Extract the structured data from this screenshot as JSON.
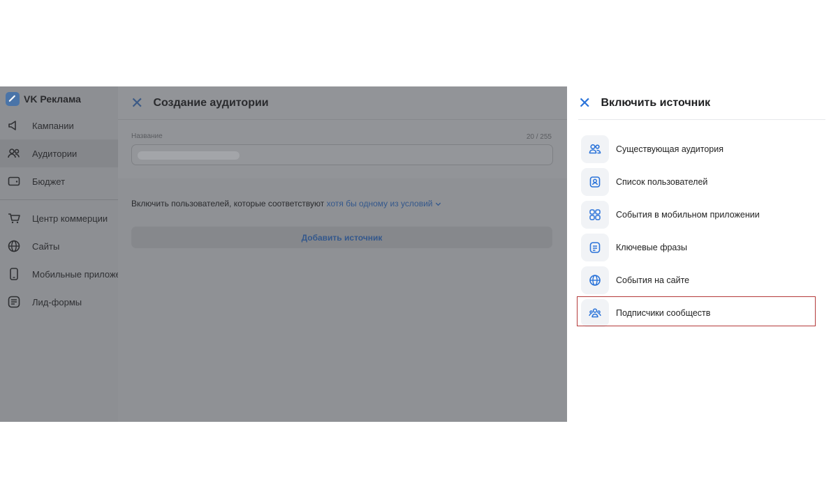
{
  "sidebar": {
    "brand": "VK Реклама",
    "items": [
      {
        "label": "Кампании",
        "icon": "megaphone-icon"
      },
      {
        "label": "Аудитории",
        "icon": "users-icon",
        "active": true
      },
      {
        "label": "Бюджет",
        "icon": "wallet-icon"
      },
      {
        "label": "Центр коммерции",
        "icon": "cart-icon"
      },
      {
        "label": "Сайты",
        "icon": "globe-icon"
      },
      {
        "label": "Мобильные приложения",
        "icon": "phone-icon"
      },
      {
        "label": "Лид-формы",
        "icon": "list-form-icon"
      }
    ]
  },
  "audience_panel": {
    "title": "Создание аудитории",
    "name_label": "Название",
    "name_counter": "20 / 255",
    "rule_text": "Включить пользователей, которые соответствуют",
    "rule_link": "хотя бы одному из условий",
    "add_source": "Добавить источник"
  },
  "drawer": {
    "title": "Включить источник",
    "sources": [
      {
        "label": "Существующая аудитория",
        "icon": "users-outline-icon"
      },
      {
        "label": "Список пользователей",
        "icon": "user-list-icon"
      },
      {
        "label": "События в мобильном приложении",
        "icon": "app-grid-icon"
      },
      {
        "label": "Ключевые фразы",
        "icon": "text-doc-icon"
      },
      {
        "label": "События на сайте",
        "icon": "globe-icon"
      },
      {
        "label": "Подписчики сообществ",
        "icon": "community-icon",
        "highlighted": true
      }
    ]
  },
  "colors": {
    "accent": "#2a73d9",
    "highlight_border": "#b43a3a",
    "overlay": "#8f9195"
  }
}
